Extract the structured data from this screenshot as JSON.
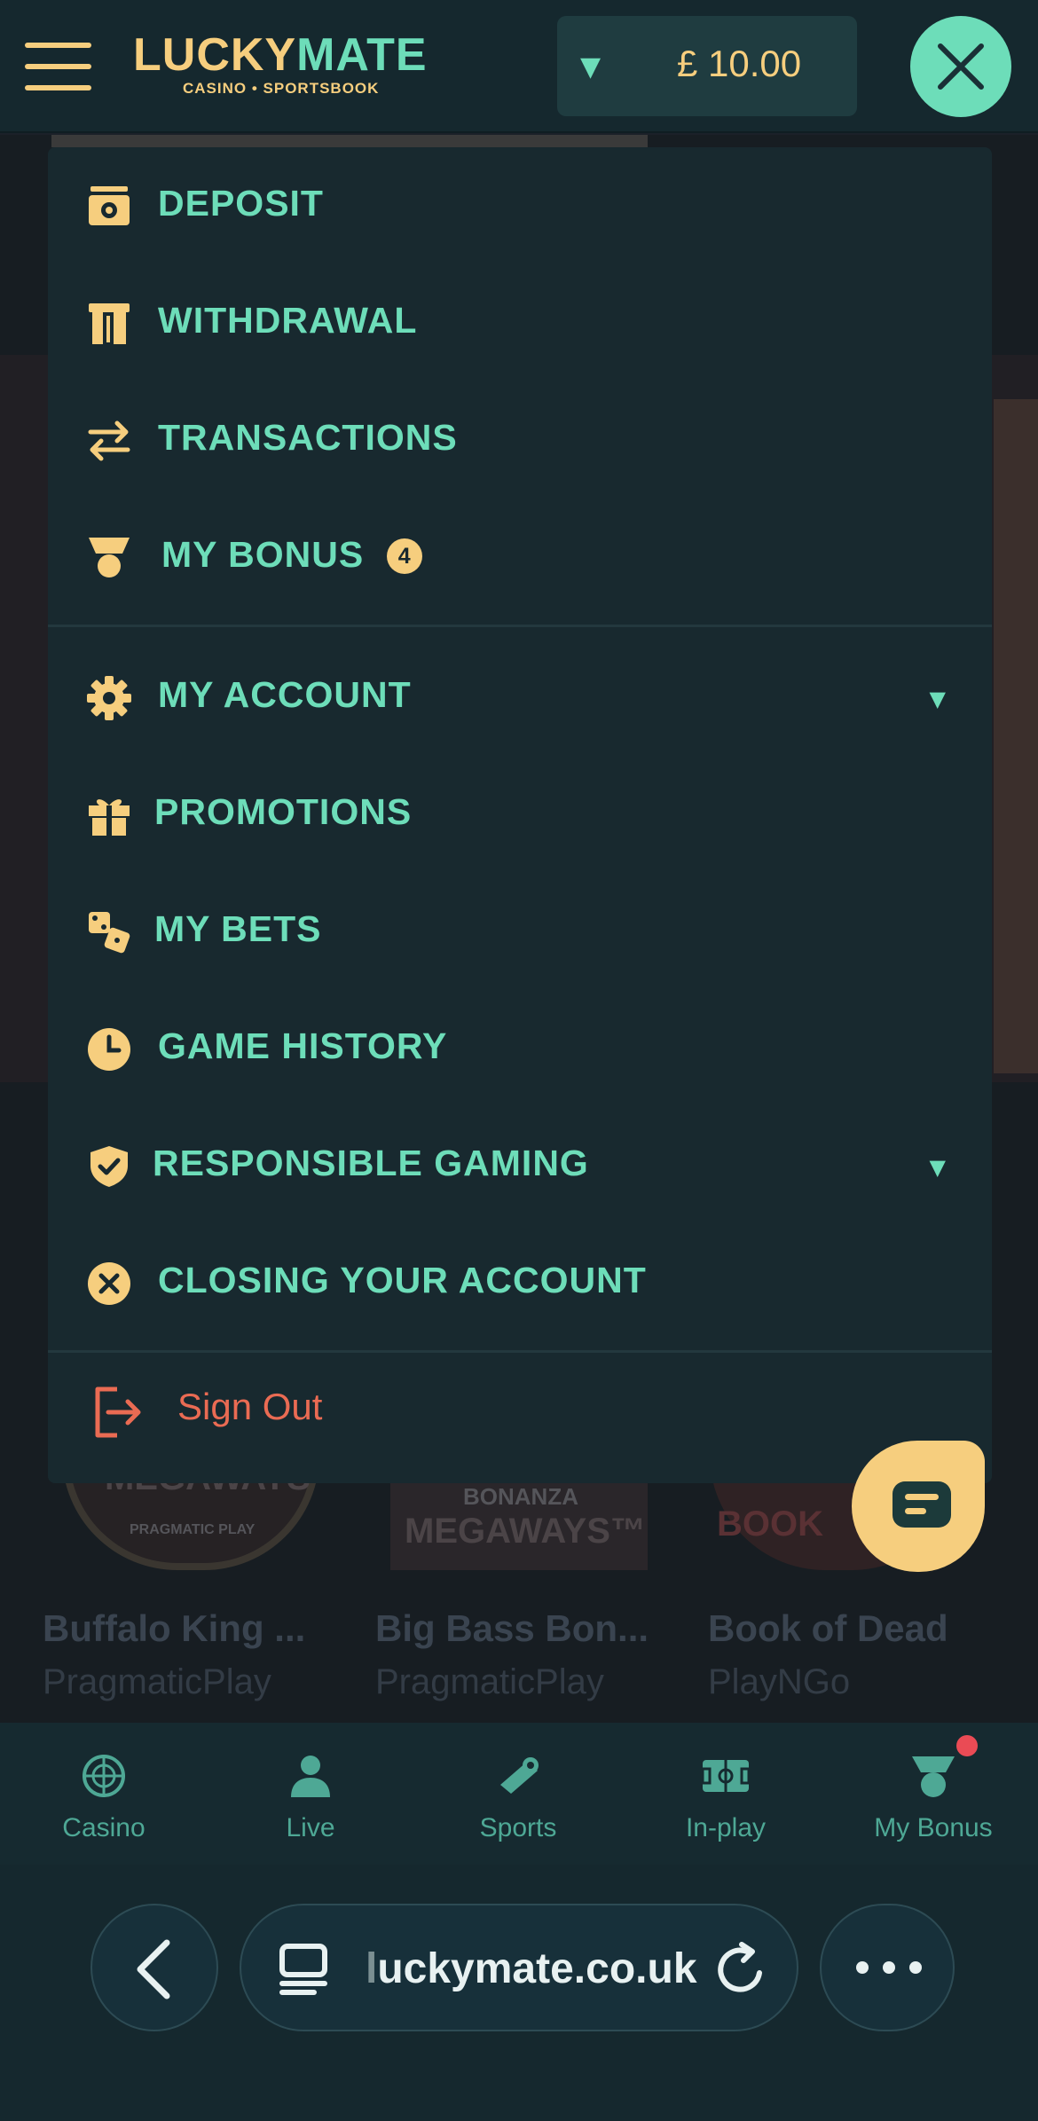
{
  "header": {
    "logo_main_1": "LUCKY",
    "logo_main_2": "MATE",
    "logo_sub": "CASINO • SPORTSBOOK",
    "balance": "£ 10.00",
    "balance_caret": "▼"
  },
  "menu": {
    "items": [
      {
        "label": "DEPOSIT",
        "icon": "wallet-icon"
      },
      {
        "label": "WITHDRAWAL",
        "icon": "withdrawal-icon"
      },
      {
        "label": "TRANSACTIONS",
        "icon": "transfer-arrows-icon"
      },
      {
        "label": "MY BONUS",
        "icon": "medal-icon",
        "badge": "4"
      },
      {
        "label": "MY ACCOUNT",
        "icon": "gear-icon",
        "arrow": "▼"
      },
      {
        "label": "PROMOTIONS",
        "icon": "gift-icon"
      },
      {
        "label": "MY BETS",
        "icon": "dice-icon"
      },
      {
        "label": "GAME HISTORY",
        "icon": "clock-icon"
      },
      {
        "label": "RESPONSIBLE GAMING",
        "icon": "shield-check-icon",
        "arrow": "▼"
      },
      {
        "label": "CLOSING YOUR ACCOUNT",
        "icon": "close-circle-icon"
      }
    ],
    "sign_out": "Sign Out"
  },
  "games": [
    {
      "name": "Buffalo King ...",
      "provider": "PragmaticPlay"
    },
    {
      "name": "Big Bass Bon...",
      "provider": "PragmaticPlay"
    },
    {
      "name": "Book of Dead",
      "provider": "PlayNGo"
    }
  ],
  "tile_text": {
    "tile1_brand": "MEGAWAYS™",
    "tile1_sub": "PRAGMATIC PLAY",
    "tile2_top": "BONANZA",
    "tile2_brand": "MEGAWAYS™",
    "tile3_brand": "BOOK"
  },
  "bottom_nav": [
    {
      "label": "Casino",
      "icon": "roulette-icon"
    },
    {
      "label": "Live",
      "icon": "dealer-icon"
    },
    {
      "label": "Sports",
      "icon": "whistle-icon"
    },
    {
      "label": "In-play",
      "icon": "pitch-icon"
    },
    {
      "label": "My Bonus",
      "icon": "medal-icon"
    }
  ],
  "browser": {
    "url_fade": "l",
    "url": "uckymate.co.uk"
  },
  "colors": {
    "accent_green": "#6dddb9",
    "accent_gold": "#f6ce7e",
    "sign_out_red": "#ea6b53",
    "panel_bg": "#18292f",
    "notification_red": "#ea4b55"
  }
}
